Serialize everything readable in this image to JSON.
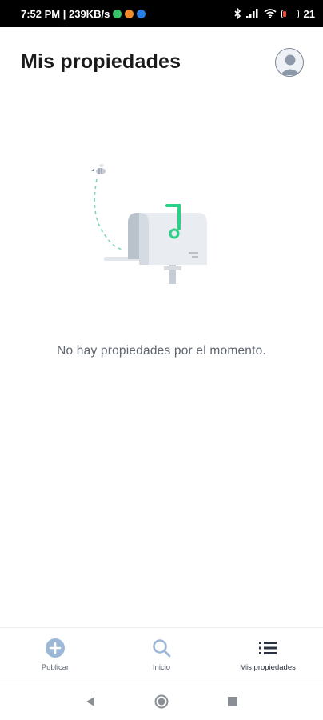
{
  "status_bar": {
    "time_info": "7:52 PM | 239KB/s",
    "battery": "21",
    "battery_level": 0.21,
    "colors": {
      "green_dot": "#39c46b",
      "orange_dot": "#f08a2c",
      "blue_dot": "#2a7de1",
      "battery_fill": "#e84a3c"
    }
  },
  "header": {
    "title": "Mis propiedades",
    "avatar_icon": "user-avatar-icon"
  },
  "empty_state": {
    "message": "No hay propiedades por el momento.",
    "illustration": "mailbox-illustration",
    "accent_color": "#2ecf86"
  },
  "bottom_nav": {
    "items": [
      {
        "label": "Publicar",
        "icon": "plus-circle-icon",
        "active": false
      },
      {
        "label": "Inicio",
        "icon": "search-icon",
        "active": false
      },
      {
        "label": "Mis propiedades",
        "icon": "list-icon",
        "active": true
      }
    ],
    "inactive_color": "#9db8d6",
    "active_color": "#2b3340"
  },
  "system_nav": {
    "buttons": [
      "back-icon",
      "home-icon",
      "recents-icon"
    ]
  }
}
